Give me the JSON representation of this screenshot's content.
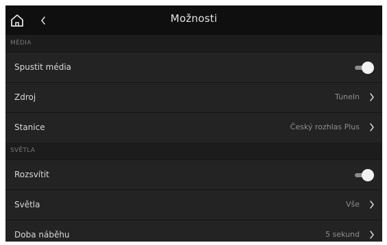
{
  "header": {
    "title": "Možnosti",
    "home_icon": "home-icon",
    "back_icon": "chevron-left-icon"
  },
  "sections": [
    {
      "header": "MÉDIA",
      "rows": [
        {
          "label": "Spustit média",
          "type": "toggle",
          "checked": true
        },
        {
          "label": "Zdroj",
          "value": "TuneIn"
        },
        {
          "label": "Stanice",
          "value": "Český rozhlas Plus"
        }
      ]
    },
    {
      "header": "SVĚTLA",
      "rows": [
        {
          "label": "Rozsvítit",
          "type": "toggle",
          "checked": true
        },
        {
          "label": "Světla",
          "value": "Vše"
        },
        {
          "label": "Doba náběhu",
          "value": "5 sekund"
        }
      ]
    }
  ],
  "colors": {
    "background": "#151515",
    "row": "#232323",
    "section_header": "#1c1c1c",
    "text": "#d9d9d9",
    "value_text": "#8f8f8f",
    "toggle_knob": "#f2f2f2"
  }
}
